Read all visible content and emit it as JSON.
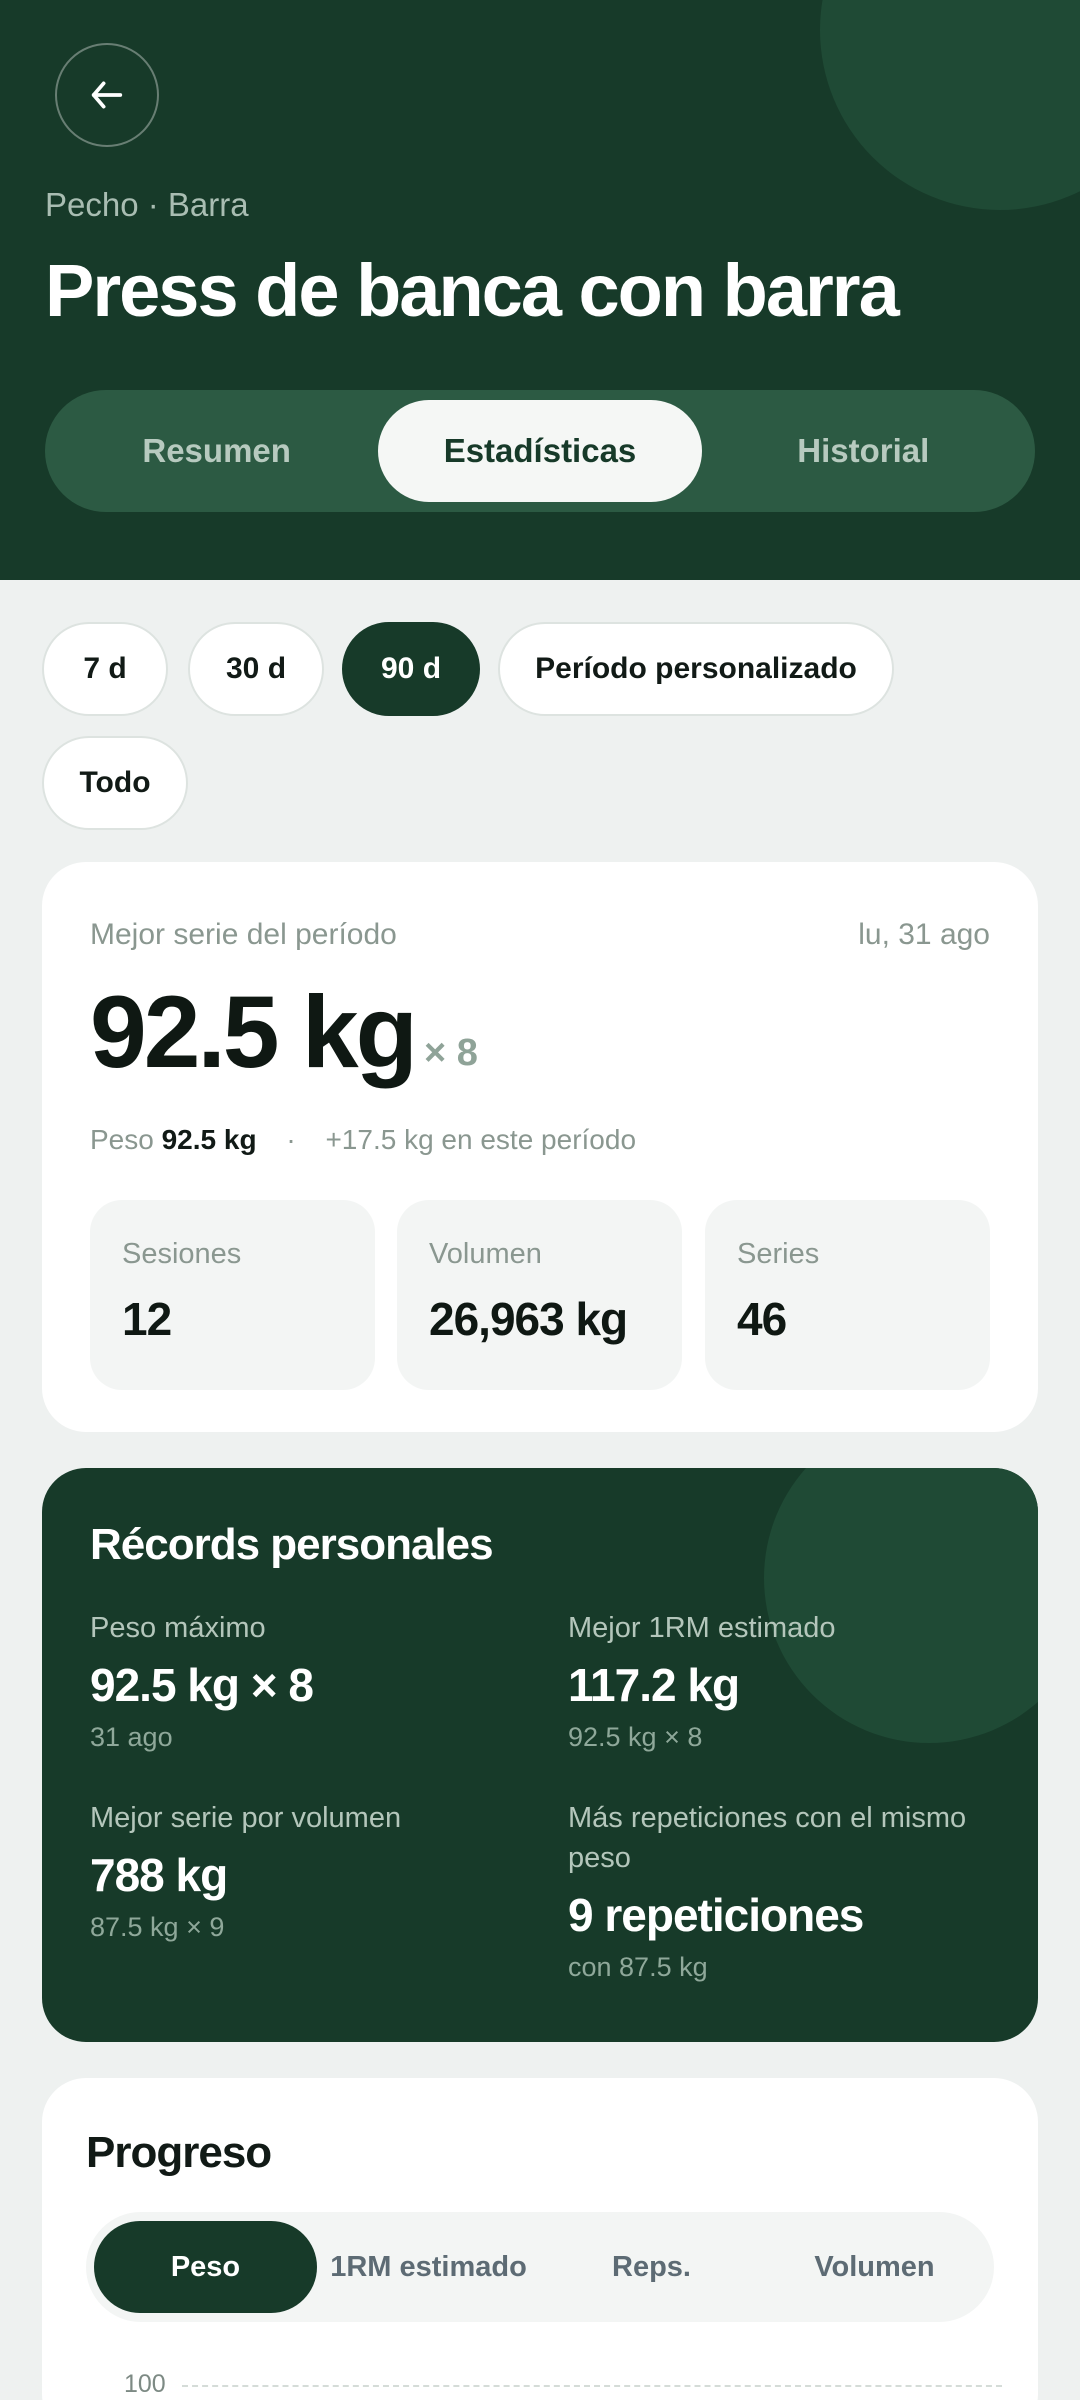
{
  "header": {
    "subtitle": "Pecho · Barra",
    "title": "Press de banca con barra",
    "tabs": [
      {
        "label": "Resumen",
        "active": false
      },
      {
        "label": "Estadísticas",
        "active": true
      },
      {
        "label": "Historial",
        "active": false
      }
    ]
  },
  "periods": [
    {
      "label": "7 d",
      "active": false
    },
    {
      "label": "30 d",
      "active": false
    },
    {
      "label": "90 d",
      "active": true
    },
    {
      "label": "Período personalizado",
      "active": false
    },
    {
      "label": "Todo",
      "active": false
    }
  ],
  "best_set": {
    "label": "Mejor serie del período",
    "date": "lu, 31 ago",
    "value": "92.5 kg",
    "reps": "× 8",
    "weight_prefix": "Peso",
    "weight_value": "92.5 kg",
    "separator": "·",
    "change": "+17.5 kg en este período",
    "stats": [
      {
        "label": "Sesiones",
        "value": "12"
      },
      {
        "label": "Volumen",
        "value": "26,963 kg"
      },
      {
        "label": "Series",
        "value": "46"
      }
    ]
  },
  "records": {
    "title": "Récords personales",
    "items": [
      {
        "label": "Peso máximo",
        "value": "92.5 kg × 8",
        "sub": "31 ago"
      },
      {
        "label": "Mejor 1RM estimado",
        "value": "117.2 kg",
        "sub": "92.5 kg × 8"
      },
      {
        "label": "Mejor serie por volumen",
        "value": "788 kg",
        "sub": "87.5 kg × 9"
      },
      {
        "label": "Más repeticiones con el mismo peso",
        "value": "9 repeticiones",
        "sub": "con 87.5 kg"
      }
    ]
  },
  "progress": {
    "title": "Progreso",
    "segments": [
      {
        "label": "Peso",
        "active": true
      },
      {
        "label": "1RM estimado",
        "active": false
      },
      {
        "label": "Reps.",
        "active": false
      },
      {
        "label": "Volumen",
        "active": false
      }
    ],
    "y_tick_top": "100"
  },
  "colors": {
    "primary_dark_green": "#173a29",
    "background": "#eef1f0"
  },
  "icons": {
    "back": "arrow-left-icon"
  }
}
